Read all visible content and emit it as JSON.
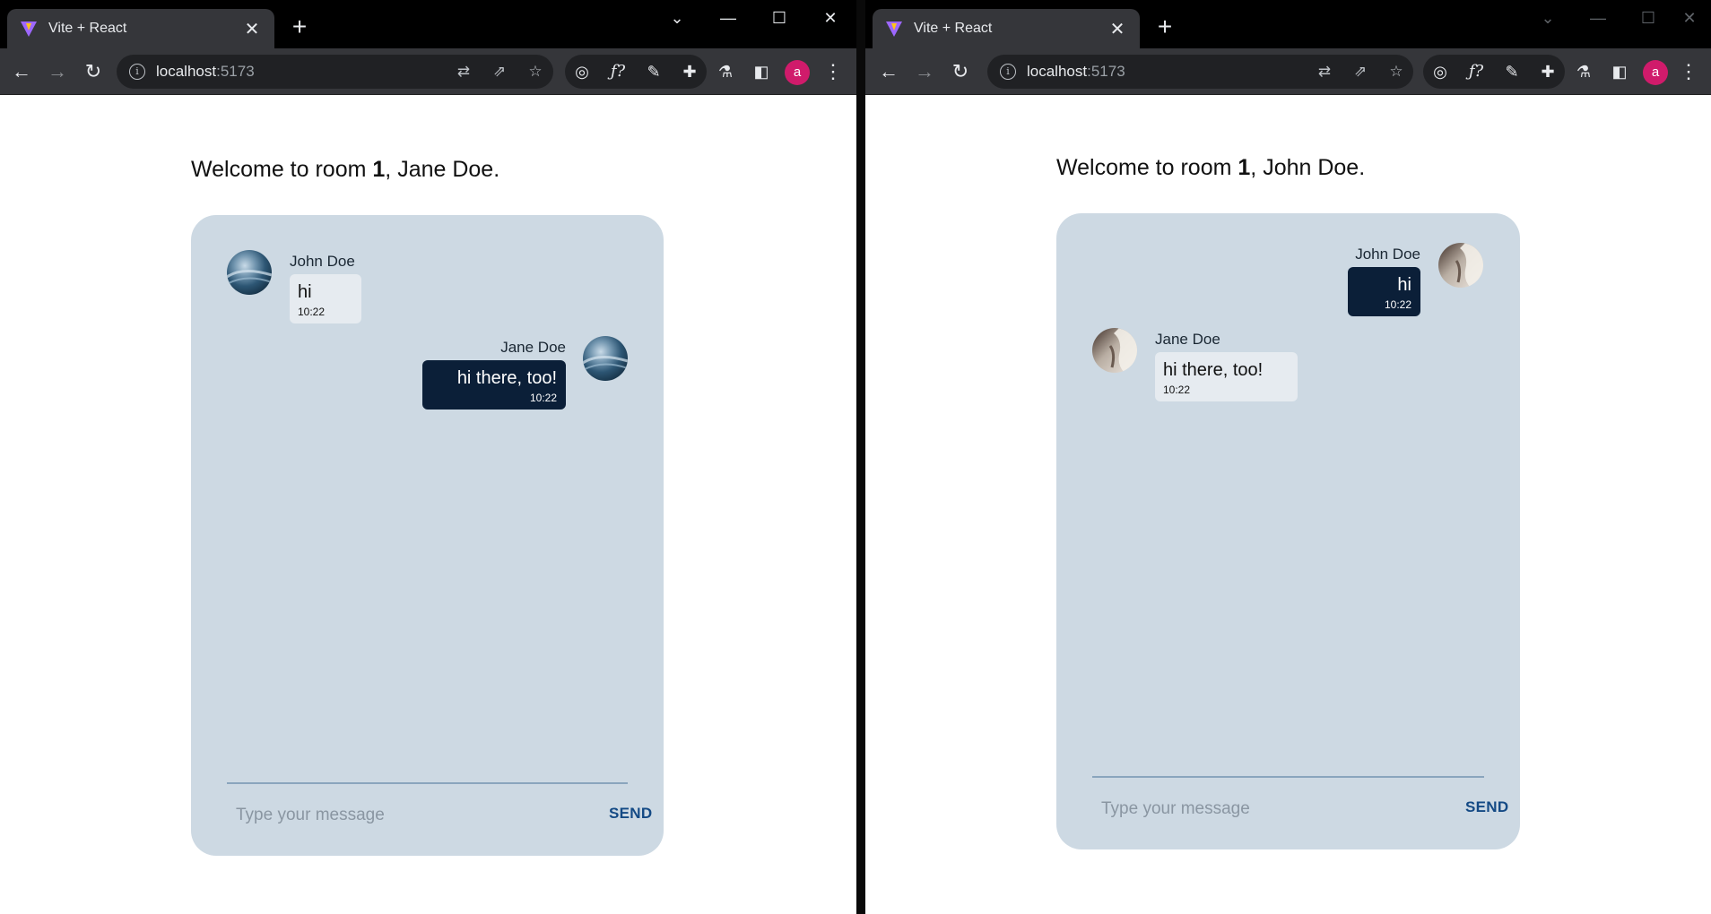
{
  "windows": [
    {
      "tab_title": "Vite + React",
      "url_host": "localhost",
      "url_port": ":5173",
      "avatar_letter": "a",
      "welcome": {
        "prefix": "Welcome to room ",
        "room": "1",
        "suffix": ", Jane Doe."
      },
      "messages": [
        {
          "sender": "John Doe",
          "text": "hi",
          "time": "10:22",
          "own": false,
          "avatar": "blue-swirl-avatar"
        },
        {
          "sender": "Jane Doe",
          "text": "hi there, too!",
          "time": "10:22",
          "own": true,
          "avatar": "blue-swirl-avatar"
        }
      ],
      "input_placeholder": "Type your message",
      "send_label": "SEND"
    },
    {
      "tab_title": "Vite + React",
      "url_host": "localhost",
      "url_port": ":5173",
      "avatar_letter": "a",
      "welcome": {
        "prefix": "Welcome to room ",
        "room": "1",
        "suffix": ", John Doe."
      },
      "messages": [
        {
          "sender": "John Doe",
          "text": "hi",
          "time": "10:22",
          "own": true,
          "avatar": "person-photo-avatar"
        },
        {
          "sender": "Jane Doe",
          "text": "hi there, too!",
          "time": "10:22",
          "own": false,
          "avatar": "person-photo-avatar"
        }
      ],
      "input_placeholder": "Type your message",
      "send_label": "SEND"
    }
  ],
  "colors": {
    "chat_bg": "#cdd9e3",
    "own_bubble": "#0b1f38",
    "other_bubble": "#e6ebf0",
    "send": "#144a85",
    "profile": "#d01b6b"
  }
}
